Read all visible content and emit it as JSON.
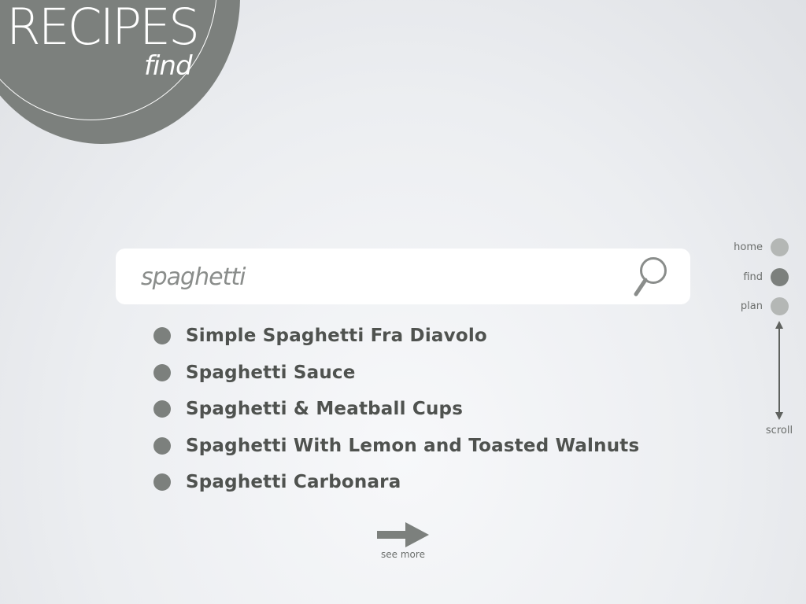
{
  "header": {
    "title": "RECIPES",
    "subtitle": "find"
  },
  "search": {
    "value": "spaghetti",
    "icon": "search-icon"
  },
  "results": [
    {
      "label": "Simple Spaghetti Fra Diavolo"
    },
    {
      "label": "Spaghetti Sauce"
    },
    {
      "label": "Spaghetti & Meatball Cups"
    },
    {
      "label": "Spaghetti With Lemon and Toasted Walnuts"
    },
    {
      "label": "Spaghetti Carbonara"
    }
  ],
  "see_more": {
    "label": "see more",
    "icon": "arrow-right-icon"
  },
  "nav": {
    "items": [
      {
        "label": "home",
        "active": false
      },
      {
        "label": "find",
        "active": true
      },
      {
        "label": "plan",
        "active": false
      }
    ],
    "scroll_label": "scroll"
  },
  "colors": {
    "accent": "#7c807d",
    "inactive_dot": "#b4b7b5",
    "text_dark": "#4f524f",
    "text_muted": "#6b6e6c",
    "background": "#eceef1"
  }
}
